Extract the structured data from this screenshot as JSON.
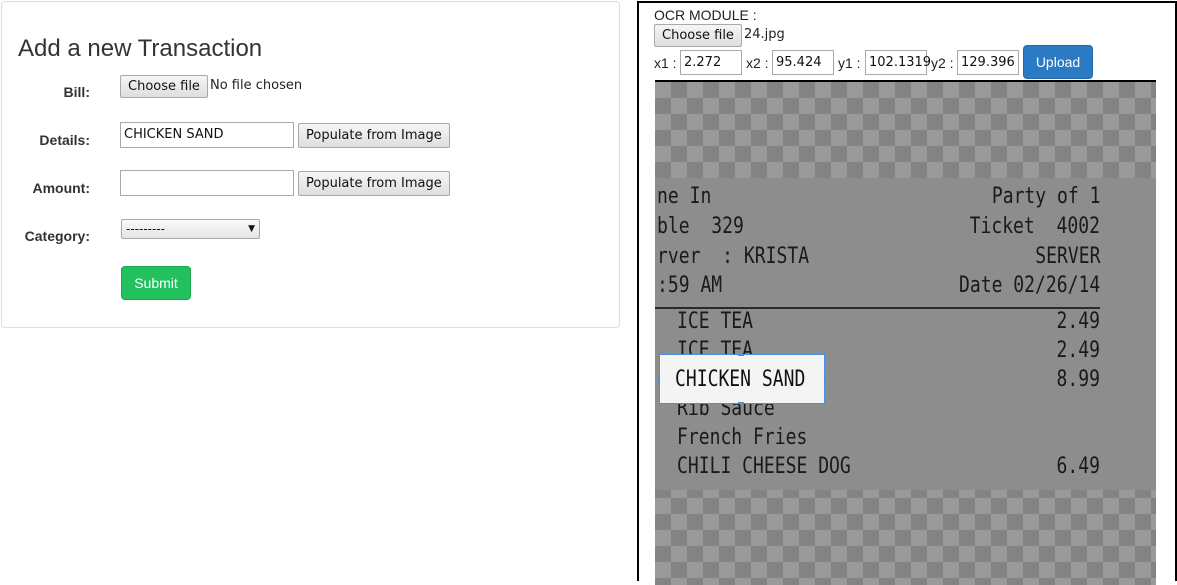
{
  "form": {
    "title": "Add a new Transaction",
    "bill_label": "Bill:",
    "choose_file_label": "Choose file",
    "no_file_text": "No file chosen",
    "details_label": "Details:",
    "details_value": "CHICKEN SAND",
    "populate_label": "Populate from Image",
    "amount_label": "Amount:",
    "amount_value": "",
    "category_label": "Category:",
    "category_selected": "---------",
    "submit_label": "Submit"
  },
  "ocr": {
    "title": "OCR MODULE :",
    "choose_file_label": "Choose file",
    "file_name": "24.jpg",
    "x1_label": "x1 :",
    "x1_value": "2.272",
    "x2_label": "x2 :",
    "x2_value": "95.424",
    "y1_label": "y1 :",
    "y1_value": "102.1319",
    "y2_label": "y2 :",
    "y2_value": "129.396",
    "upload_label": "Upload",
    "receipt": {
      "line1_left": "ne In",
      "line1_right": "Party of 1",
      "line2_left": "ble  329",
      "line2_right": "Ticket  4002",
      "line3_left": "rver  : KRISTA",
      "line3_right": "SERVER",
      "line4_left": ":59 AM",
      "line4_right": "Date 02/26/14",
      "item1_name": "ICE TEA",
      "item1_price": "2.49",
      "item2_name": "ICE TEA",
      "item2_price": "2.49",
      "item3_name": "CHICKEN SAND",
      "item3_price": "8.99",
      "item4_name": "Rib Sauce",
      "item5_name": "French Fries",
      "item6_name": "CHILI CHEESE DOG",
      "item6_price": "6.49"
    }
  },
  "colors": {
    "submit": "#22c15e",
    "upload": "#2b7bc4",
    "crop_border": "#4a90e2"
  }
}
